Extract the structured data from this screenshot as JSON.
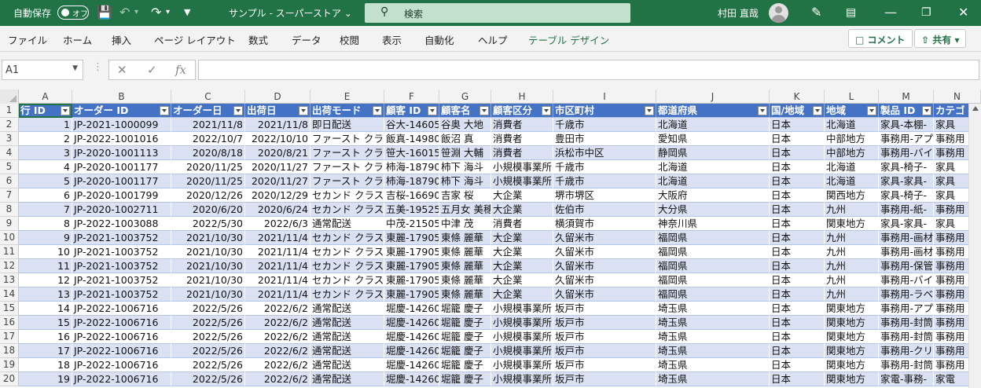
{
  "titlebar": {
    "autosave_label": "自動保存",
    "autosave_toggle": "オフ",
    "doc_title": "サンプル - スーパーストア",
    "search_placeholder": "検索",
    "user_name": "村田 直哉"
  },
  "ribbon": {
    "tabs": [
      "ファイル",
      "ホーム",
      "挿入",
      "ページ レイアウト",
      "数式",
      "データ",
      "校閲",
      "表示",
      "自動化",
      "ヘルプ",
      "テーブル デザイン"
    ],
    "comment_label": "コメント",
    "share_label": "共有"
  },
  "formula_bar": {
    "name_box": "A1",
    "fx": "fx",
    "content": ""
  },
  "columns": [
    "A",
    "B",
    "C",
    "D",
    "E",
    "F",
    "G",
    "H",
    "I",
    "J",
    "K",
    "L",
    "M",
    "N"
  ],
  "row_numbers": [
    "1",
    "2",
    "3",
    "4",
    "5",
    "6",
    "7",
    "8",
    "9",
    "10",
    "11",
    "12",
    "13",
    "14",
    "15",
    "16",
    "17",
    "18",
    "19",
    "20"
  ],
  "table_headers": [
    "行 ID",
    "オーダー ID",
    "オーダー日",
    "出荷日",
    "出荷モード",
    "顧客 ID",
    "顧客名",
    "顧客区分",
    "市区町村",
    "都道府県",
    "国/地域",
    "地域",
    "製品 ID",
    "カテゴ"
  ],
  "rows": [
    [
      "1",
      "JP-2021-1000099",
      "2021/11/8",
      "2021/11/8",
      "即日配送",
      "谷大-14605",
      "谷奥 大地",
      "消費者",
      "千歳市",
      "北海道",
      "日本",
      "北海道",
      "家具-本棚-",
      "家具"
    ],
    [
      "2",
      "JP-2022-1001016",
      "2022/10/7",
      "2022/10/10",
      "ファースト クラ",
      "飯真-14980",
      "飯沼 真",
      "消費者",
      "豊田市",
      "愛知県",
      "日本",
      "中部地方",
      "事務用-アプ",
      "事務用"
    ],
    [
      "3",
      "JP-2020-1001113",
      "2020/8/18",
      "2020/8/21",
      "ファースト クラ",
      "笹大-16015",
      "笹淵 大輔",
      "消費者",
      "浜松市中区",
      "静岡県",
      "日本",
      "中部地方",
      "事務用-バイ",
      "事務用"
    ],
    [
      "4",
      "JP-2020-1001177",
      "2020/11/25",
      "2020/11/27",
      "ファースト クラ",
      "柿海-18790",
      "柿下 海斗",
      "小規模事業所",
      "千歳市",
      "北海道",
      "日本",
      "北海道",
      "家具-椅子-",
      "家具"
    ],
    [
      "5",
      "JP-2020-1001177",
      "2020/11/25",
      "2020/11/27",
      "ファースト クラ",
      "柿海-18790",
      "柿下 海斗",
      "小規模事業所",
      "千歳市",
      "北海道",
      "日本",
      "北海道",
      "家具-家具-",
      "家具"
    ],
    [
      "6",
      "JP-2020-1001799",
      "2020/12/26",
      "2020/12/29",
      "セカンド クラス",
      "吉桜-16690",
      "吉家 桜",
      "大企業",
      "堺市堺区",
      "大阪府",
      "日本",
      "関西地方",
      "家具-椅子-",
      "家具"
    ],
    [
      "7",
      "JP-2020-1002711",
      "2020/6/20",
      "2020/6/24",
      "セカンド クラス",
      "五美-19525",
      "五月女 美穂",
      "大企業",
      "佐伯市",
      "大分県",
      "日本",
      "九州",
      "事務用-紙-",
      "事務用"
    ],
    [
      "8",
      "JP-2022-1003088",
      "2022/5/30",
      "2022/6/3",
      "通常配送",
      "中茂-21505",
      "中津 茂",
      "消費者",
      "横須賀市",
      "神奈川県",
      "日本",
      "関東地方",
      "家具-家具-",
      "家具"
    ],
    [
      "9",
      "JP-2021-1003752",
      "2021/10/30",
      "2021/11/4",
      "セカンド クラス",
      "東麗-17905",
      "東條 麗華",
      "大企業",
      "久留米市",
      "福岡県",
      "日本",
      "九州",
      "事務用-画材",
      "事務用"
    ],
    [
      "10",
      "JP-2021-1003752",
      "2021/10/30",
      "2021/11/4",
      "セカンド クラス",
      "東麗-17905",
      "東條 麗華",
      "大企業",
      "久留米市",
      "福岡県",
      "日本",
      "九州",
      "事務用-画材",
      "事務用"
    ],
    [
      "11",
      "JP-2021-1003752",
      "2021/10/30",
      "2021/11/4",
      "セカンド クラス",
      "東麗-17905",
      "東條 麗華",
      "大企業",
      "久留米市",
      "福岡県",
      "日本",
      "九州",
      "事務用-保管",
      "事務用"
    ],
    [
      "12",
      "JP-2021-1003752",
      "2021/10/30",
      "2021/11/4",
      "セカンド クラス",
      "東麗-17905",
      "東條 麗華",
      "大企業",
      "久留米市",
      "福岡県",
      "日本",
      "九州",
      "事務用-バイ",
      "事務用"
    ],
    [
      "13",
      "JP-2021-1003752",
      "2021/10/30",
      "2021/11/4",
      "セカンド クラス",
      "東麗-17905",
      "東條 麗華",
      "大企業",
      "久留米市",
      "福岡県",
      "日本",
      "九州",
      "事務用-ラベ",
      "事務用"
    ],
    [
      "14",
      "JP-2022-1006716",
      "2022/5/26",
      "2022/6/2",
      "通常配送",
      "堀慶-14260",
      "堀籠 慶子",
      "小規模事業所",
      "坂戸市",
      "埼玉県",
      "日本",
      "関東地方",
      "事務用-アプ",
      "事務用"
    ],
    [
      "15",
      "JP-2022-1006716",
      "2022/5/26",
      "2022/6/2",
      "通常配送",
      "堀慶-14260",
      "堀籠 慶子",
      "小規模事業所",
      "坂戸市",
      "埼玉県",
      "日本",
      "関東地方",
      "事務用-封筒",
      "事務用"
    ],
    [
      "16",
      "JP-2022-1006716",
      "2022/5/26",
      "2022/6/2",
      "通常配送",
      "堀慶-14260",
      "堀籠 慶子",
      "小規模事業所",
      "坂戸市",
      "埼玉県",
      "日本",
      "関東地方",
      "事務用-封筒",
      "事務用"
    ],
    [
      "17",
      "JP-2022-1006716",
      "2022/5/26",
      "2022/6/2",
      "通常配送",
      "堀慶-14260",
      "堀籠 慶子",
      "小規模事業所",
      "坂戸市",
      "埼玉県",
      "日本",
      "関東地方",
      "事務用-クリ",
      "事務用"
    ],
    [
      "18",
      "JP-2022-1006716",
      "2022/5/26",
      "2022/6/2",
      "通常配送",
      "堀慶-14260",
      "堀籠 慶子",
      "小規模事業所",
      "坂戸市",
      "埼玉県",
      "日本",
      "関東地方",
      "事務用-封筒",
      "事務用"
    ],
    [
      "19",
      "JP-2022-1006716",
      "2022/5/26",
      "2022/6/2",
      "通常配送",
      "堀慶-14260",
      "堀籠 慶子",
      "小規模事業所",
      "坂戸市",
      "埼玉県",
      "日本",
      "関東地方",
      "家電-事務-",
      "家電"
    ],
    [
      "20",
      "JP-2022-1008702",
      "2022/9/30",
      "2022/10/4",
      "通常配送",
      "皆学-10465",
      "皆川 学",
      "消費者",
      "旭川市",
      "北海道",
      "日本",
      "北海道",
      "事務用-封筒",
      "事務用"
    ]
  ],
  "colors": {
    "accent": "#217346",
    "table_header": "#4472c4",
    "band": "#d9e1f2"
  }
}
